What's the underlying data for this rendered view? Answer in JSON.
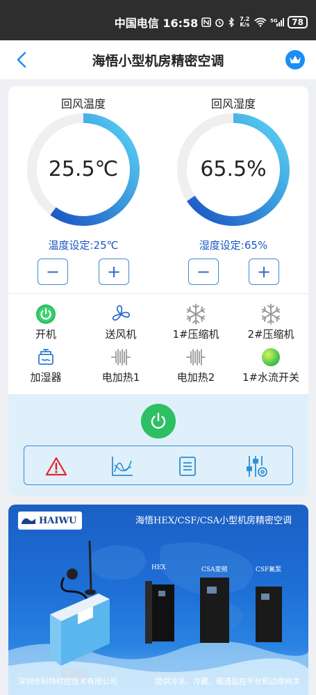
{
  "status_bar": {
    "carrier_time": "中国电信 16:58",
    "net_speed": "7.2 K/s",
    "battery": "78",
    "icons": [
      "nfc-icon",
      "alarm-icon",
      "bluetooth-icon",
      "speed-icon",
      "wifi-icon",
      "signal-5g-icon",
      "battery-icon"
    ]
  },
  "header": {
    "title": "海悟小型机房精密空调",
    "back_icon": "back-chevron-icon",
    "crown_icon": "crown-icon",
    "accent": "#1a8ef5"
  },
  "gauges": [
    {
      "title": "回风温度",
      "value_text": "25.5℃",
      "level": 0.6,
      "setpoint_label": "温度设定:25℃",
      "minus": "−",
      "plus": "+"
    },
    {
      "title": "回风湿度",
      "value_text": "65.5%",
      "level": 0.655,
      "setpoint_label": "湿度设定:65%",
      "minus": "−",
      "plus": "+"
    }
  ],
  "devices": [
    {
      "label": "开机",
      "icon": "power-on-icon"
    },
    {
      "label": "送风机",
      "icon": "fan-icon"
    },
    {
      "label": "1#压缩机",
      "icon": "snowflake-icon"
    },
    {
      "label": "2#压缩机",
      "icon": "snowflake-icon"
    },
    {
      "label": "加湿器",
      "icon": "humidifier-icon"
    },
    {
      "label": "电加热1",
      "icon": "heater-icon"
    },
    {
      "label": "电加热2",
      "icon": "heater-icon"
    },
    {
      "label": "1#水流开关",
      "icon": "water-flow-indicator-icon"
    }
  ],
  "controls": {
    "power_icon": "power-icon",
    "power_color": "#2dbf63",
    "tools": [
      "alarm-warning-icon",
      "trend-chart-icon",
      "log-list-icon",
      "settings-sliders-icon"
    ]
  },
  "banner": {
    "logo_text": "HAIWU",
    "headline": "海悟HEX/CSF/CSA小型机房精密空调",
    "units": [
      "HEX",
      "CSA变频",
      "CSF氟泵"
    ],
    "footer_left": "深圳市科特时控技术有限公司",
    "footer_right": "提供冷冻、冷藏、暖通监控平台和边缘网关"
  }
}
